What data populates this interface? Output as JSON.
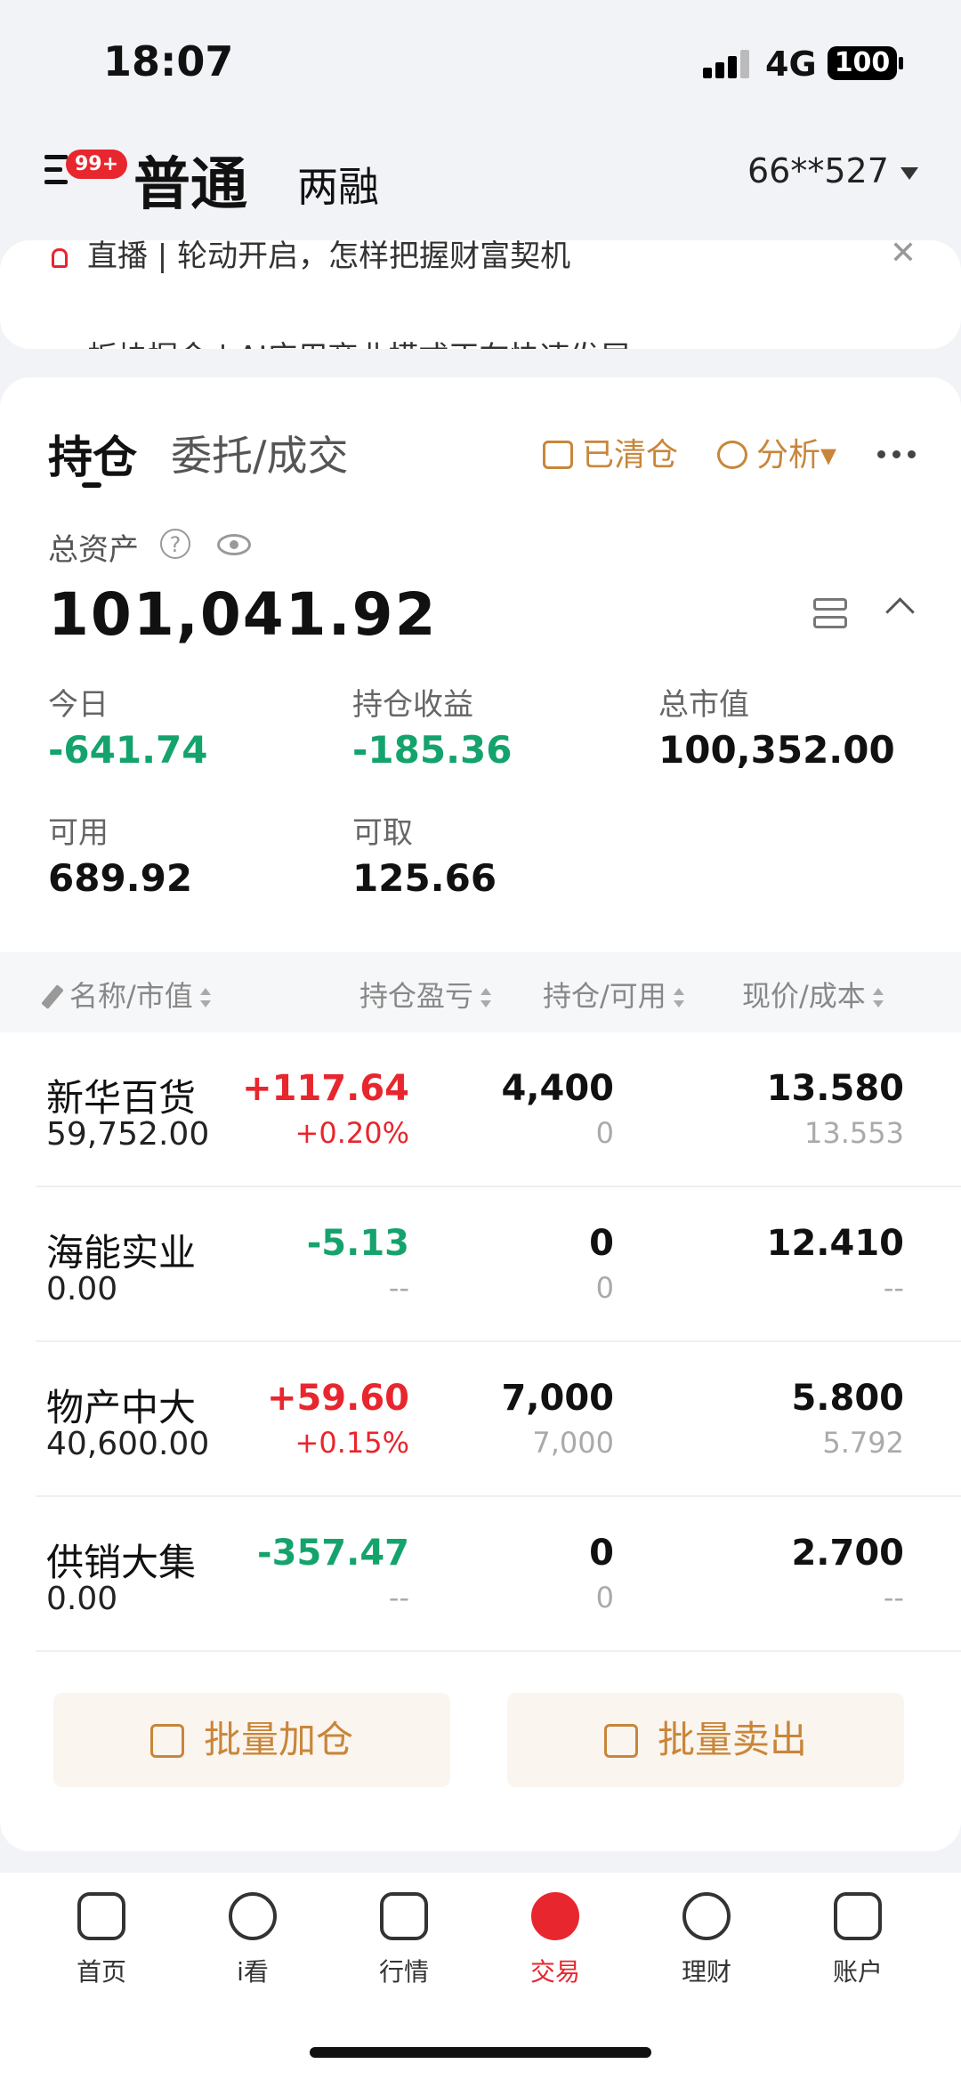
{
  "status": {
    "time": "18:07",
    "network": "4G",
    "battery": "100"
  },
  "header": {
    "badge": "99+",
    "tab_main": "普通",
    "tab_sub": "两融",
    "account": "66**527"
  },
  "notices": [
    {
      "text": "直播 | 轮动开启，怎样把握财富契机"
    },
    {
      "text": "板块掘金 | AI应用商业模式正在快速发展"
    }
  ],
  "card": {
    "tab_hold": "持仓",
    "tab_order": "委托/成交",
    "cleared": "已清仓",
    "analysis": "分析",
    "total_label": "总资产",
    "help": "?",
    "total_value": "101,041.92",
    "stats": {
      "today_label": "今日",
      "today_value": "-641.74",
      "hold_pnl_label": "持仓收益",
      "hold_pnl_value": "-185.36",
      "mkt_label": "总市值",
      "mkt_value": "100,352.00",
      "avail_label": "可用",
      "avail_value": "689.92",
      "withdraw_label": "可取",
      "withdraw_value": "125.66"
    },
    "table_headers": {
      "name": "名称/市值",
      "pnl": "持仓盈亏",
      "qty": "持仓/可用",
      "price": "现价/成本"
    },
    "positions": [
      {
        "name": "新华百货",
        "mv": "59,752.00",
        "pnl": "+117.64",
        "pct": "+0.20%",
        "qty": "4,400",
        "avail": "0",
        "price": "13.580",
        "cost": "13.553"
      },
      {
        "name": "海能实业",
        "mv": "0.00",
        "pnl": "-5.13",
        "pct": "--",
        "qty": "0",
        "avail": "0",
        "price": "12.410",
        "cost": "--"
      },
      {
        "name": "物产中大",
        "mv": "40,600.00",
        "pnl": "+59.60",
        "pct": "+0.15%",
        "qty": "7,000",
        "avail": "7,000",
        "price": "5.800",
        "cost": "5.792"
      },
      {
        "name": "供销大集",
        "mv": "0.00",
        "pnl": "-357.47",
        "pct": "--",
        "qty": "0",
        "avail": "0",
        "price": "2.700",
        "cost": "--"
      }
    ],
    "batch_add": "批量加仓",
    "batch_sell": "批量卖出"
  },
  "tabbar": [
    {
      "label": "首页",
      "icon": "home-icon"
    },
    {
      "label": "i看",
      "icon": "play-icon"
    },
    {
      "label": "行情",
      "icon": "chart-icon"
    },
    {
      "label": "交易",
      "icon": "trade-icon"
    },
    {
      "label": "理财",
      "icon": "finance-icon"
    },
    {
      "label": "账户",
      "icon": "account-icon"
    }
  ],
  "colors": {
    "accent_red": "#e8262e",
    "gain_green": "#14a36c",
    "gold": "#c8863a"
  }
}
